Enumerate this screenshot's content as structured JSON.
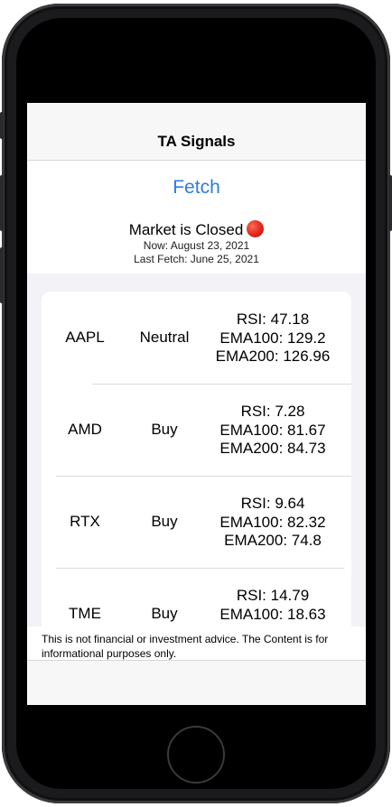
{
  "nav": {
    "title": "TA Signals"
  },
  "fetch_label": "Fetch",
  "market": {
    "status": "Market is Closed",
    "indicator_color": "#e0261a",
    "now": "Now: August 23, 2021",
    "last_fetch": "Last Fetch: June 25, 2021"
  },
  "signals": [
    {
      "symbol": "AAPL",
      "signal": "Neutral",
      "rsi": "RSI: 47.18",
      "ema100": "EMA100: 129.2",
      "ema200": "EMA200: 126.96"
    },
    {
      "symbol": "AMD",
      "signal": "Buy",
      "rsi": "RSI: 7.28",
      "ema100": "EMA100: 81.67",
      "ema200": "EMA200: 84.73"
    },
    {
      "symbol": "RTX",
      "signal": "Buy",
      "rsi": "RSI: 9.64",
      "ema100": "EMA100: 82.32",
      "ema200": "EMA200: 74.8"
    },
    {
      "symbol": "TME",
      "signal": "Buy",
      "rsi": "RSI: 14.79",
      "ema100": "EMA100: 18.63",
      "ema200": ""
    }
  ],
  "disclaimer": "This is not financial or investment advice. The Content is for informational purposes only.",
  "colors": {
    "accent": "#2f7ce0",
    "list_background": "#f2f2f7"
  }
}
